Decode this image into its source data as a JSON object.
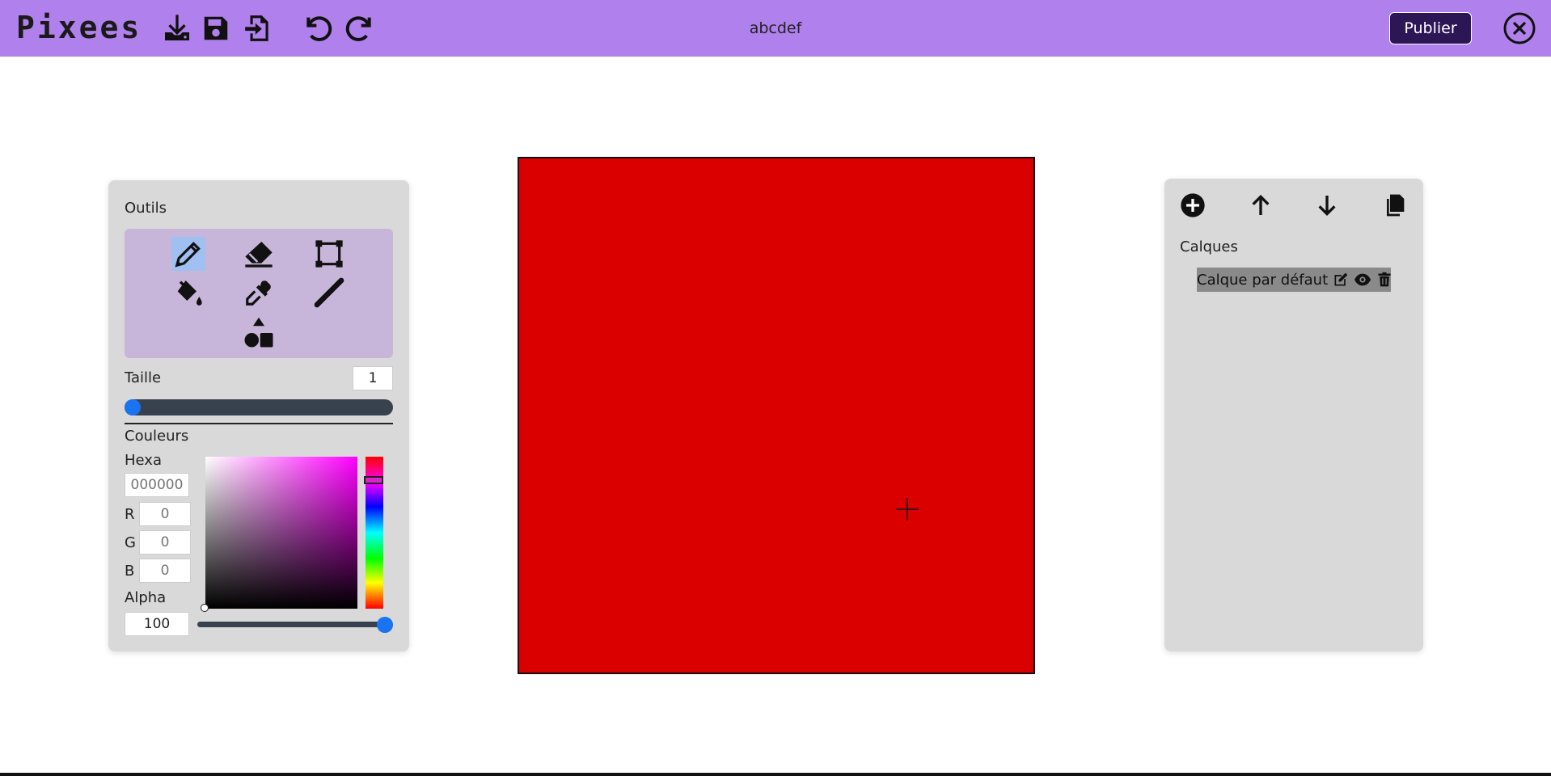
{
  "app": {
    "logo": "Pixees",
    "document_title": "abcdef",
    "publish_label": "Publier"
  },
  "tools_panel": {
    "title": "Outils",
    "tools": [
      "pencil",
      "eraser",
      "select-rect",
      "paint-bucket",
      "eyedropper",
      "line",
      "shapes"
    ],
    "selected_tool": "pencil",
    "size_label": "Taille",
    "size_value": "1",
    "size_slider_fraction": 0.0
  },
  "colors": {
    "title": "Couleurs",
    "hexa_label": "Hexa",
    "hexa_placeholder": "000000",
    "r_label": "R",
    "g_label": "G",
    "b_label": "B",
    "r_placeholder": "0",
    "g_placeholder": "0",
    "b_placeholder": "0",
    "alpha_label": "Alpha",
    "alpha_value": "100",
    "alpha_slider_fraction": 1.0,
    "hue_color": "#ff00ff"
  },
  "canvas": {
    "fill_color": "#db0000"
  },
  "layers_panel": {
    "title": "Calques",
    "layers": [
      {
        "name": "Calque par défaut",
        "selected": true
      }
    ]
  },
  "theme": {
    "topbar_bg": "#b080ec",
    "publish_bg": "#2d1656",
    "panel_bg": "#d9d9d9",
    "tools_grid_bg": "#c7b6da",
    "slider_accent": "#1a73f0"
  }
}
